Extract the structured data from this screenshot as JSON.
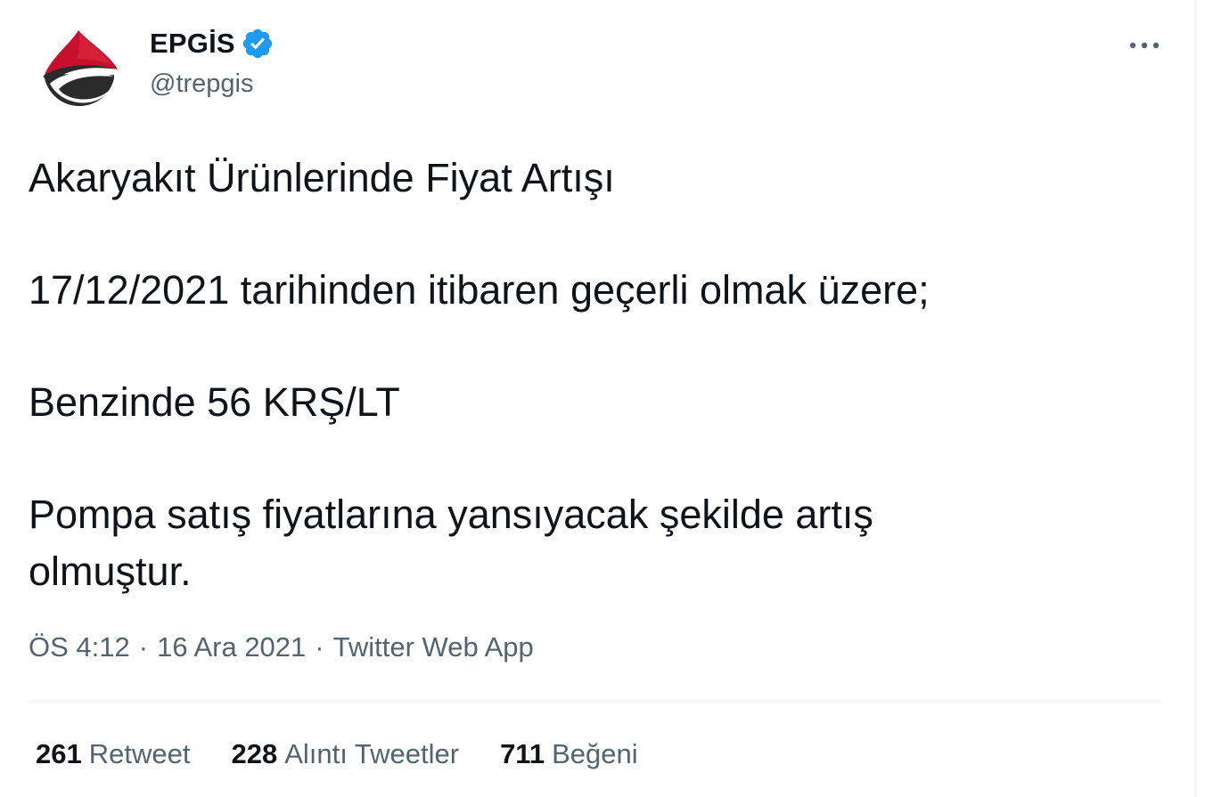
{
  "author": {
    "display_name": "EPGİS",
    "handle": "@trepgis",
    "verified_icon": "verified-badge-icon"
  },
  "menu": {
    "more_icon": "more-horizontal-icon"
  },
  "tweet": {
    "paragraphs": [
      "Akaryakıt Ürünlerinde Fiyat Artışı",
      "17/12/2021 tarihinden itibaren geçerli olmak üzere;",
      "Benzinde 56 KRŞ/LT",
      "Pompa satış fiyatlarına yansıyacak şekilde artış\nolmuştur."
    ]
  },
  "meta": {
    "time": "ÖS 4:12",
    "separator": "·",
    "date": "16 Ara 2021",
    "source": "Twitter Web App"
  },
  "stats": {
    "retweets": {
      "count": "261",
      "label": "Retweet"
    },
    "quotes": {
      "count": "228",
      "label": "Alıntı Tweetler"
    },
    "likes": {
      "count": "711",
      "label": "Beğeni"
    }
  },
  "colors": {
    "text_primary": "#0f1419",
    "text_secondary": "#536471",
    "verified_blue": "#1d9bf0",
    "logo_red": "#c8102e",
    "logo_dark": "#2b2b2b",
    "divider": "#eff3f4"
  }
}
